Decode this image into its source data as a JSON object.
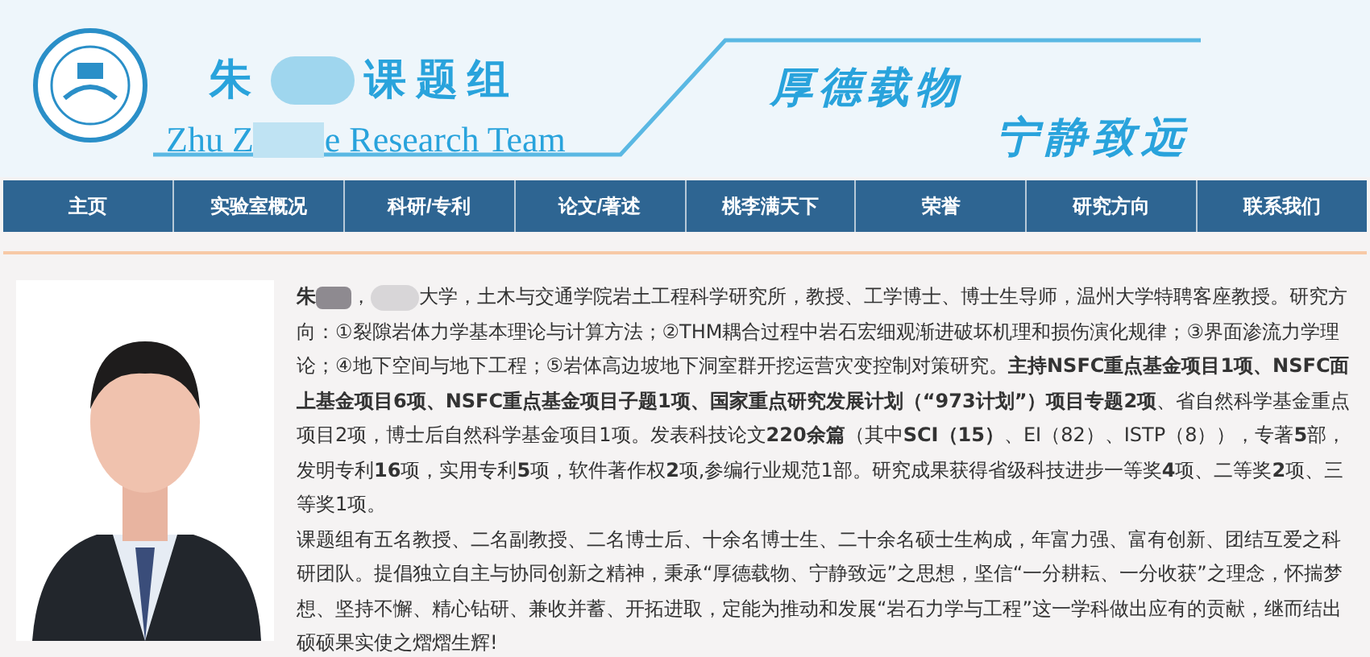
{
  "header": {
    "title_cn": [
      "朱",
      "课题组"
    ],
    "title_en": [
      "Zhu Z",
      "e Research Team"
    ],
    "mottos": [
      "厚德载物",
      "宁静致远"
    ]
  },
  "nav": [
    {
      "label": "主页"
    },
    {
      "label": "实验室概况"
    },
    {
      "label": "科研/专利"
    },
    {
      "label": "论文/著述"
    },
    {
      "label": "桃李满天下"
    },
    {
      "label": "荣誉"
    },
    {
      "label": "研究方向"
    },
    {
      "label": "联系我们"
    }
  ],
  "profile": {
    "name_lead": "朱",
    "bio": "，",
    "bio_rest": "大学，土木与交通学院岩土工程科学研究所，教授、工学博士、博士生导师，温州大学特聘客座教授。研究方向：①裂隙岩体力学基本理论与计算方法；②THM耦合过程中岩石宏细观渐进破坏机理和损伤演化规律；③界面渗流力学理论；④地下空间与地下工程；⑤岩体高边坡地下洞室群开挖运营灾变控制对策研究。**主持NSFC重点基金项目1项、NSFC面上基金项目6项、NSFC重点基金项目子题1项、国家重点研究发展计划（“973计划”）项目专题2项**、省自然科学基金重点项目2项，博士后自然科学基金项目1项。发表科技论文**220余篇**（其中**SCI（15）**、EI（82）、ISTP（8）），专著**5**部，发明专利**16**项，实用专利**5**项，软件著作权**2**项,参编行业规范1部。研究成果获得省级科技进步一等奖**4**项、二等奖**2**项、三等奖1项。",
    "team": "课题组有五名教授、二名副教授、二名博士后、十余名博士生、二十余名硕士生构成，年富力强、富有创新、团结互爱之科研团队。提倡独立自主与协同创新之精神，秉承“厚德载物、宁静致远”之思想，坚信“一分耕耘、一分收获”之理念，怀揣梦想、坚持不懈、精心钻研、兼收并蓄、开拓进取，定能为推动和发展“岩石力学与工程”这一学科做出应有的贡献，继而结出硕硕果实使之熠熠生辉!"
  }
}
